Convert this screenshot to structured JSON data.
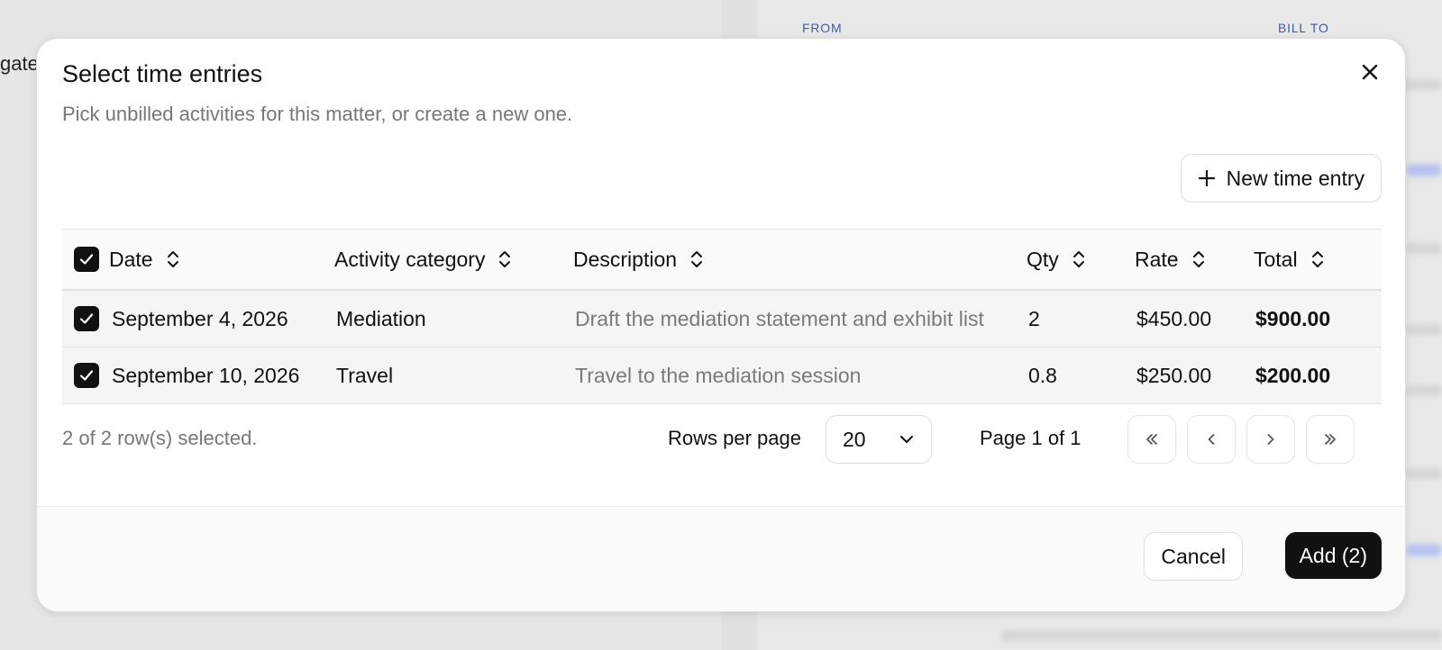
{
  "background": {
    "from_label": "FROM",
    "bill_to_label": "BILL TO",
    "left_fragment": "gate"
  },
  "dialog": {
    "title": "Select time entries",
    "subtitle": "Pick unbilled activities for this matter, or create a new one.",
    "new_entry_label": "New time entry",
    "columns": {
      "date": "Date",
      "category": "Activity category",
      "description": "Description",
      "qty": "Qty",
      "rate": "Rate",
      "total": "Total"
    },
    "rows": [
      {
        "date": "September 4, 2026",
        "category": "Mediation",
        "description": "Draft the mediation statement and exhibit list",
        "qty": "2",
        "rate": "$450.00",
        "total": "$900.00",
        "checked": true
      },
      {
        "date": "September 10, 2026",
        "category": "Travel",
        "description": "Travel to the mediation session",
        "qty": "0.8",
        "rate": "$250.00",
        "total": "$200.00",
        "checked": true
      }
    ],
    "selection_text": "2 of 2 row(s) selected.",
    "rows_per_page_label": "Rows per page",
    "rows_per_page_value": "20",
    "page_label": "Page 1 of 1",
    "cancel_label": "Cancel",
    "add_label": "Add (2)"
  },
  "icons": {
    "close": "close-icon",
    "plus": "plus-icon",
    "sort": "sort-icon",
    "check": "check-icon",
    "chevron_down": "chevron-down-icon",
    "first_page": "chevrons-left-icon",
    "prev_page": "chevron-left-icon",
    "next_page": "chevron-right-icon",
    "last_page": "chevrons-right-icon"
  },
  "colors": {
    "primary": "#111111",
    "muted_text": "#777777",
    "accent_label": "#3b5bb5"
  }
}
